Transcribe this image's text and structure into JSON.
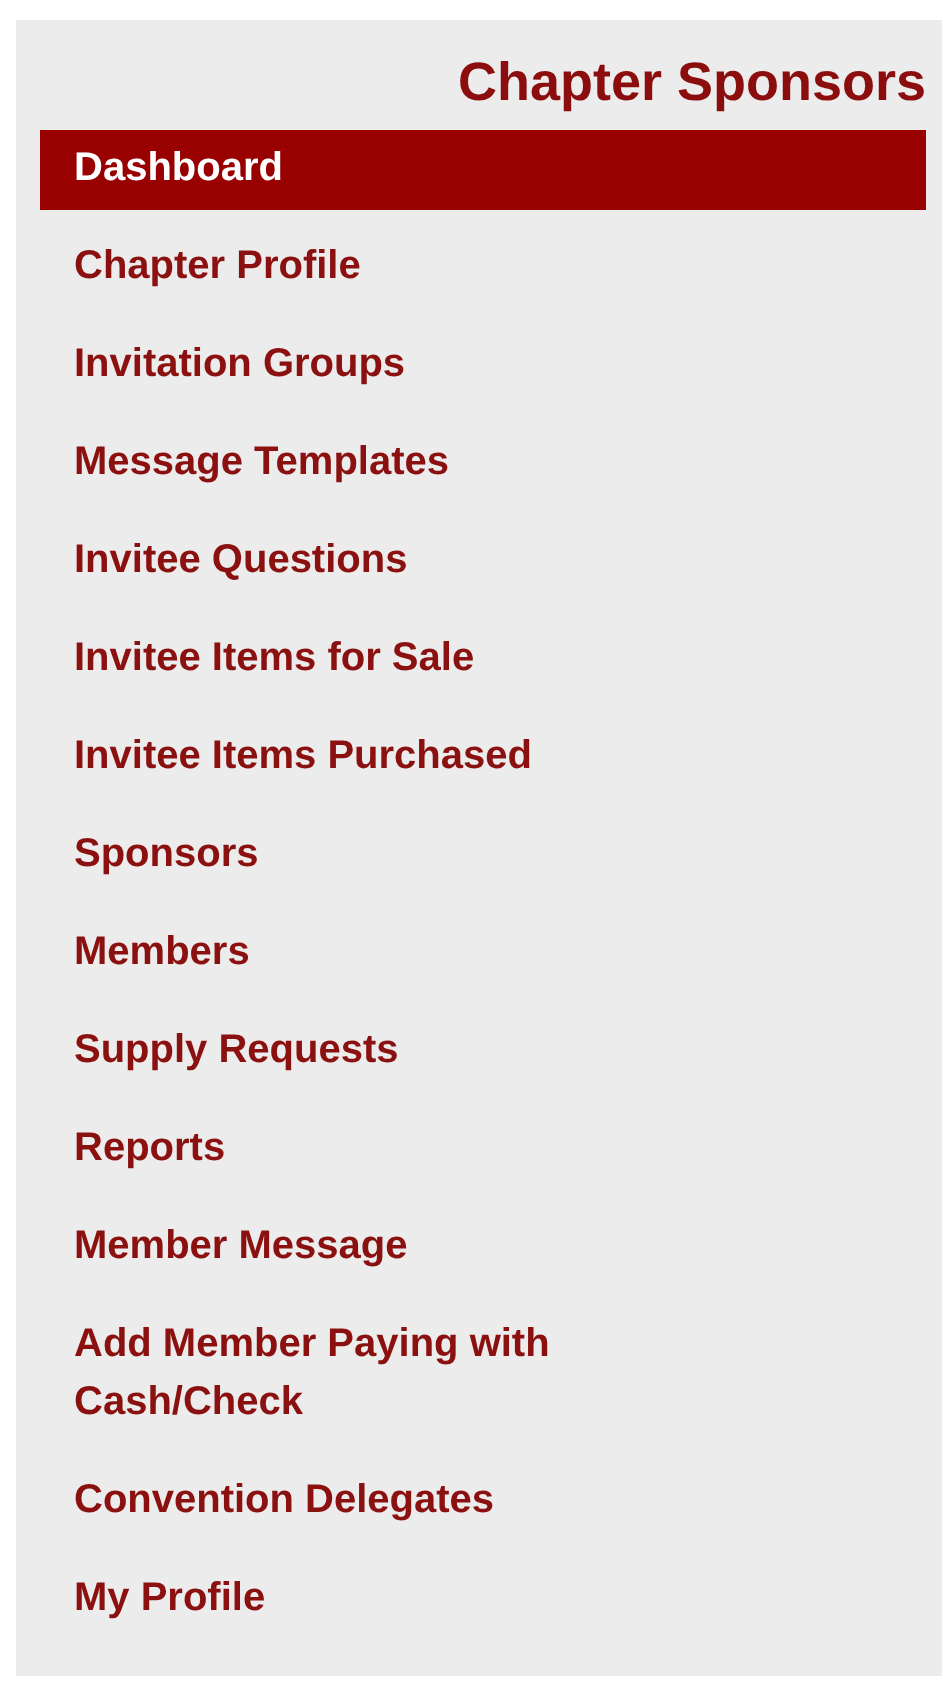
{
  "sidebar": {
    "title": "Chapter Sponsors",
    "items": [
      {
        "label": "Dashboard",
        "selected": true
      },
      {
        "label": "Chapter Profile",
        "selected": false
      },
      {
        "label": "Invitation Groups",
        "selected": false
      },
      {
        "label": "Message Templates",
        "selected": false
      },
      {
        "label": "Invitee Questions",
        "selected": false
      },
      {
        "label": "Invitee Items for Sale",
        "selected": false
      },
      {
        "label": "Invitee Items Purchased",
        "selected": false
      },
      {
        "label": "Sponsors",
        "selected": false
      },
      {
        "label": "Members",
        "selected": false
      },
      {
        "label": "Supply Requests",
        "selected": false
      },
      {
        "label": "Reports",
        "selected": false
      },
      {
        "label": "Member Message",
        "selected": false
      },
      {
        "label": "Add Member Paying with Cash/Check",
        "selected": false
      },
      {
        "label": "Convention Delegates",
        "selected": false
      },
      {
        "label": "My Profile",
        "selected": false
      }
    ]
  }
}
